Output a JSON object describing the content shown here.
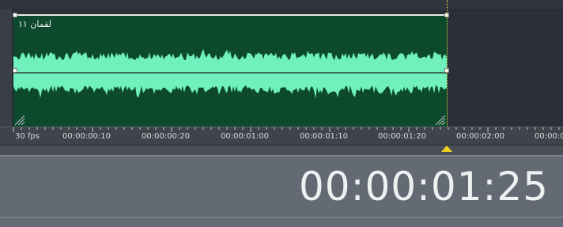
{
  "clip": {
    "label": "لقمان ۱۱"
  },
  "ruler": {
    "fps_label": "30 fps",
    "ticks": [
      "00:00:00:10",
      "00:00:00:20",
      "00:00:01:00",
      "00:00:01:10",
      "00:00:01:20",
      "00:00:02:00",
      "00:00:0"
    ]
  },
  "timecode": {
    "current": "00:00:01:25"
  },
  "colors": {
    "clip_background": "#0d4a2d",
    "waveform": "#6ff0bd",
    "playhead": "#f1d320"
  }
}
